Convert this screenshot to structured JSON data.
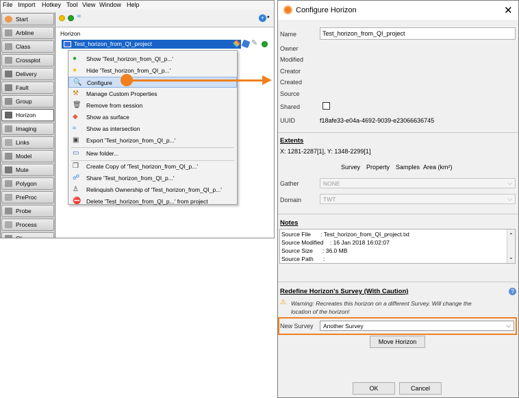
{
  "menubar": {
    "items": [
      "File",
      "Import",
      "Hotkey",
      "Tool",
      "View",
      "Window",
      "Help"
    ]
  },
  "colors": {
    "accent_orange": "#f0801e",
    "selection_blue": "#1a64c8",
    "menu_highlight": "#cfe0f6"
  },
  "tabs": [
    {
      "label": "Start",
      "icon": "start-icon"
    },
    {
      "label": "Arbline",
      "icon": "arbline-icon"
    },
    {
      "label": "Class",
      "icon": "class-icon"
    },
    {
      "label": "Crossplot",
      "icon": "crossplot-icon"
    },
    {
      "label": "Delivery",
      "icon": "delivery-icon"
    },
    {
      "label": "Fault",
      "icon": "fault-icon"
    },
    {
      "label": "Group",
      "icon": "group-icon"
    },
    {
      "label": "Horizon",
      "icon": "horizon-icon",
      "active": true
    },
    {
      "label": "Imaging",
      "icon": "imaging-icon"
    },
    {
      "label": "Links",
      "icon": "links-icon"
    },
    {
      "label": "Model",
      "icon": "model-icon"
    },
    {
      "label": "Mute",
      "icon": "mute-icon"
    },
    {
      "label": "Polygon",
      "icon": "polygon-icon"
    },
    {
      "label": "PreProc",
      "icon": "preproc-icon"
    },
    {
      "label": "Probe",
      "icon": "probe-icon"
    },
    {
      "label": "Process",
      "icon": "process-icon"
    },
    {
      "label": "QI",
      "icon": "qi-icon"
    }
  ],
  "panel": {
    "title": "Horizon",
    "selected_item": "Test_horizon_from_QI_project"
  },
  "context_menu": [
    {
      "label": "Show 'Test_horizon_from_QI_p...'",
      "icon": "green-dot-icon"
    },
    {
      "label": "Hide 'Test_horizon_from_QI_p...'",
      "icon": "yellow-dot-icon"
    },
    {
      "label": "Configure",
      "icon": "magnifier-icon",
      "highlighted": true
    },
    {
      "label": "Manage Custom Properties",
      "icon": "wrench-icon"
    },
    {
      "label": "Remove from session",
      "icon": "trash-icon"
    },
    {
      "label": "Show as surface",
      "icon": "surface-icon"
    },
    {
      "label": "Show as intersection",
      "icon": "intersection-icon"
    },
    {
      "label": "Export 'Test_horizon_from_QI_p...'",
      "icon": "export-icon"
    },
    {
      "label": "New folder...",
      "icon": "folder-icon",
      "separator_before": true
    },
    {
      "label": "Create Copy of 'Test_horizon_from_QI_p...'",
      "icon": "copy-icon",
      "separator_before": true
    },
    {
      "label": "Share 'Test_horizon_from_QI_p...'",
      "icon": "share-icon"
    },
    {
      "label": "Relinquish Ownership of 'Test_horizon_from_QI_p...'",
      "icon": "relinquish-icon"
    },
    {
      "label": "Delete 'Test_horizon_from_QI_p...' from project",
      "icon": "delete-icon"
    }
  ],
  "dialog": {
    "title": "Configure Horizon",
    "close": "✕",
    "fields": {
      "name_label": "Name",
      "name_value": "Test_horizon_from_QI_project",
      "owner_label": "Owner",
      "modified_label": "Modified",
      "creator_label": "Creator",
      "created_label": "Created",
      "source_label": "Source",
      "shared_label": "Shared",
      "uuid_label": "UUID",
      "uuid_value": "f18afe33-e04a-4692-9039-e23066636745"
    },
    "extents": {
      "header": "Extents",
      "range": "X: 1281-2287[1], Y: 1348-2299[1]",
      "table_headers": [
        "Survey",
        "Property",
        "Samples",
        "Area (km²)"
      ]
    },
    "gather": {
      "label": "Gather",
      "value": "NONE"
    },
    "domain": {
      "label": "Domain",
      "value": "TWT"
    },
    "notes": {
      "header": "Notes",
      "lines": [
        "Source File      : Test_horizon_from_QI_project.txt",
        "Source Modified    : 16 Jan 2018 16:02:07",
        "Source Size      : 36.0 MB",
        "Source Path      :"
      ]
    },
    "redefine": {
      "header": "Redefine Horizon's Survey (With Caution)",
      "warning_line1": "Warning: Recreates this horizon on a different Survey. Will change the",
      "warning_line2": "location of the horizon!",
      "new_survey_label": "New Survey",
      "new_survey_value": "Another Survey",
      "move_button": "Move Horizon"
    },
    "ok_button": "OK",
    "cancel_button": "Cancel"
  }
}
